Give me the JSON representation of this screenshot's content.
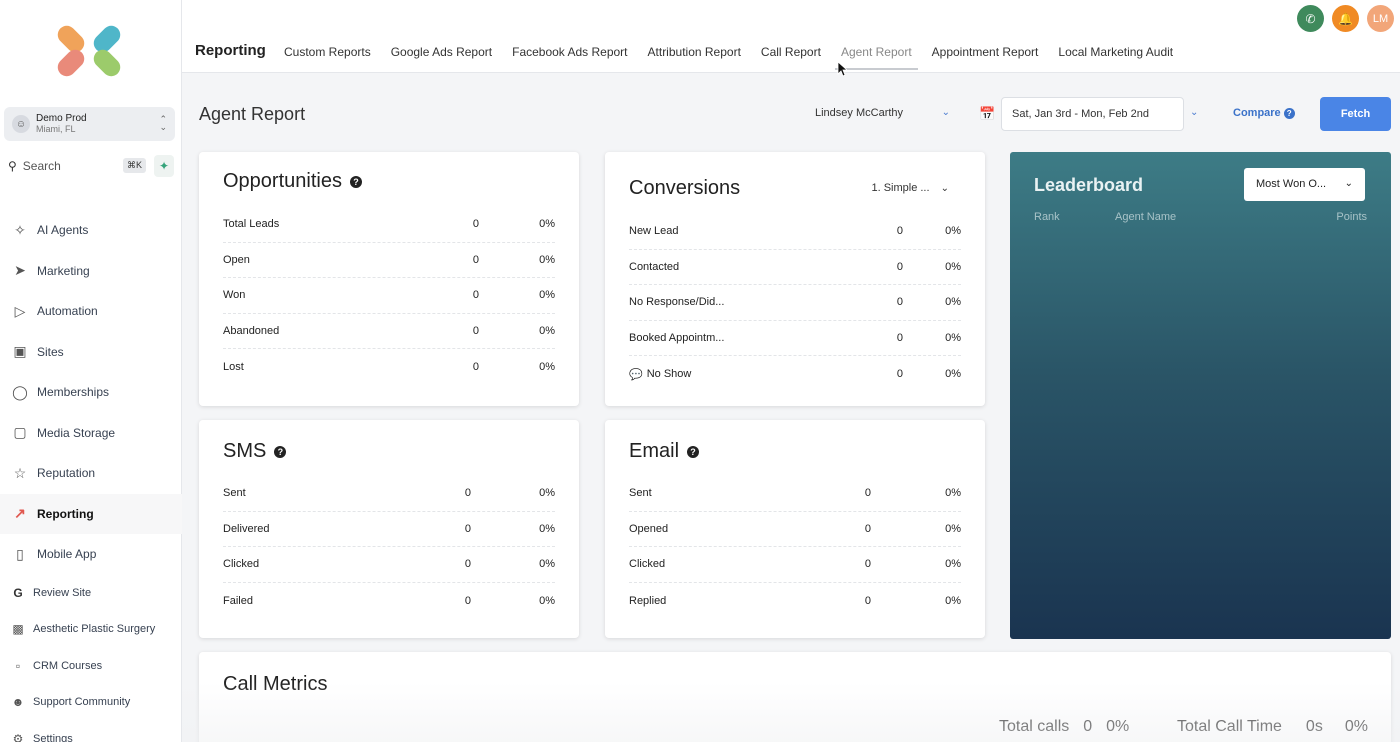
{
  "sidebar": {
    "account": {
      "name": "Demo Prod",
      "location": "Miami, FL"
    },
    "search": {
      "placeholder": "Search",
      "shortcut": "⌘K"
    },
    "items": [
      {
        "label": "AI Agents",
        "icon": "sparkles-icon"
      },
      {
        "label": "Marketing",
        "icon": "paper-plane-icon"
      },
      {
        "label": "Automation",
        "icon": "play-circle-icon"
      },
      {
        "label": "Sites",
        "icon": "site-icon"
      },
      {
        "label": "Memberships",
        "icon": "award-icon"
      },
      {
        "label": "Media Storage",
        "icon": "image-icon"
      },
      {
        "label": "Reputation",
        "icon": "star-icon"
      },
      {
        "label": "Reporting",
        "icon": "trend-icon",
        "active": true
      },
      {
        "label": "Mobile App",
        "icon": "phone-icon"
      },
      {
        "label": "Review Site",
        "icon": "google-icon"
      },
      {
        "label": "Aesthetic Plastic Surgery",
        "icon": "laptop-icon"
      },
      {
        "label": "CRM Courses",
        "icon": "courses-icon"
      },
      {
        "label": "Support Community",
        "icon": "people-icon"
      },
      {
        "label": "Settings",
        "icon": "gear-icon"
      }
    ]
  },
  "topbar": {
    "section": "Reporting",
    "tabs": [
      "Custom Reports",
      "Google Ads Report",
      "Facebook Ads Report",
      "Attribution Report",
      "Call Report",
      "Agent Report",
      "Appointment Report",
      "Local Marketing Audit"
    ],
    "active_tab": "Agent Report",
    "avatar_initials": "LM",
    "colors": {
      "phone": "#3f8a5c",
      "bell": "#f08a24",
      "avatar": "#f2a679"
    }
  },
  "header": {
    "title": "Agent Report",
    "agent": "Lindsey McCarthy",
    "date_range": "Sat, Jan 3rd - Mon, Feb 2nd",
    "compare_label": "Compare",
    "fetch_label": "Fetch"
  },
  "opportunities": {
    "title": "Opportunities",
    "rows": [
      {
        "label": "Total Leads",
        "value": "0",
        "pct": "0%"
      },
      {
        "label": "Open",
        "value": "0",
        "pct": "0%"
      },
      {
        "label": "Won",
        "value": "0",
        "pct": "0%"
      },
      {
        "label": "Abandoned",
        "value": "0",
        "pct": "0%"
      },
      {
        "label": "Lost",
        "value": "0",
        "pct": "0%"
      }
    ]
  },
  "conversions": {
    "title": "Conversions",
    "select": "1. Simple ...",
    "rows": [
      {
        "label": "New Lead",
        "value": "0",
        "pct": "0%"
      },
      {
        "label": "Contacted",
        "value": "0",
        "pct": "0%"
      },
      {
        "label": "No Response/Did...",
        "value": "0",
        "pct": "0%"
      },
      {
        "label": "Booked Appointm...",
        "value": "0",
        "pct": "0%"
      },
      {
        "label": "No Show",
        "value": "0",
        "pct": "0%"
      }
    ]
  },
  "sms": {
    "title": "SMS",
    "rows": [
      {
        "label": "Sent",
        "value": "0",
        "pct": "0%"
      },
      {
        "label": "Delivered",
        "value": "0",
        "pct": "0%"
      },
      {
        "label": "Clicked",
        "value": "0",
        "pct": "0%"
      },
      {
        "label": "Failed",
        "value": "0",
        "pct": "0%"
      }
    ]
  },
  "email": {
    "title": "Email",
    "rows": [
      {
        "label": "Sent",
        "value": "0",
        "pct": "0%"
      },
      {
        "label": "Opened",
        "value": "0",
        "pct": "0%"
      },
      {
        "label": "Clicked",
        "value": "0",
        "pct": "0%"
      },
      {
        "label": "Replied",
        "value": "0",
        "pct": "0%"
      }
    ]
  },
  "leaderboard": {
    "title": "Leaderboard",
    "select": "Most Won O...",
    "columns": [
      "Rank",
      "Agent Name",
      "Points"
    ]
  },
  "call_metrics": {
    "title": "Call Metrics",
    "total_calls_label": "Total calls",
    "total_calls_value": "0",
    "total_calls_pct": "0%",
    "total_time_label": "Total Call Time",
    "total_time_value": "0s",
    "total_time_pct": "0%"
  }
}
